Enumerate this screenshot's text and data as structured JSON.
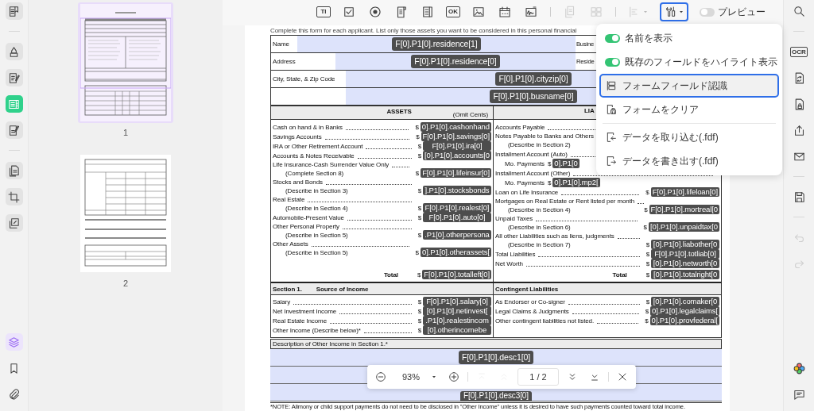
{
  "left_rail": {
    "tools": [
      {
        "kind": "reader",
        "selected": false
      },
      {
        "kind": "highlighter",
        "selected": false
      },
      {
        "kind": "edit",
        "selected": false
      },
      {
        "kind": "form",
        "selected": true
      },
      {
        "kind": "sign",
        "selected": false
      },
      {
        "kind": "pages",
        "selected": false
      },
      {
        "kind": "crop",
        "selected": false
      },
      {
        "kind": "batch",
        "selected": false
      }
    ],
    "panels": [
      {
        "kind": "layers",
        "selected": true
      },
      {
        "kind": "bookmark",
        "selected": false
      },
      {
        "kind": "attachment",
        "selected": false
      }
    ]
  },
  "thumbnails": [
    {
      "label": "1",
      "selected": true
    },
    {
      "label": "2",
      "selected": false
    }
  ],
  "toolbar": {
    "tool_groups": [
      [
        {
          "kind": "text-field",
          "label": "TI",
          "disabled": false
        },
        {
          "kind": "checkbox",
          "disabled": false
        },
        {
          "kind": "radio",
          "disabled": false
        },
        {
          "kind": "list-box",
          "disabled": false
        },
        {
          "kind": "combo-box",
          "disabled": false
        },
        {
          "kind": "push-button",
          "label": "OK",
          "disabled": false
        },
        {
          "kind": "image",
          "disabled": false
        },
        {
          "kind": "date",
          "disabled": false
        },
        {
          "kind": "signature",
          "disabled": false
        }
      ],
      [
        {
          "kind": "duplicate",
          "disabled": true
        },
        {
          "kind": "grid",
          "disabled": true
        }
      ],
      [
        {
          "kind": "align",
          "disabled": true
        }
      ]
    ],
    "form_tools_button": {
      "selected": true
    },
    "preview": {
      "label": "プレビュー",
      "on": false
    }
  },
  "document": {
    "intro": "Complete this form for each applicant.  List only those assets you want to be considered in this personal financial",
    "header_rows": [
      {
        "label": "Name",
        "field": "F[0].P1[0].residence[1]",
        "right_label": "Busine"
      },
      {
        "label": "Address",
        "field": "F[0].P1[0].residence[0]",
        "right_label": "Reside"
      },
      {
        "label": "City, State, & Zip Code",
        "field": "F[0].P1[0].cityzip[0]"
      },
      {
        "field": "F[0].P1[0].busname[0]"
      }
    ],
    "assets_title": "ASSETS",
    "assets_note": "(Omit Cents)",
    "liabilities_title": "LIA",
    "assets": [
      {
        "kind": "line",
        "label": "Cash on hand & in Banks",
        "currency": "$",
        "field": "0].P1[0].cashonhand"
      },
      {
        "kind": "line",
        "label": "Savings Accounts",
        "currency": "$",
        "field": "F[0].P1[0].savings[0]"
      },
      {
        "kind": "line",
        "label": "IRA or Other Retirement Account",
        "currency": "$",
        "field": "F[0].P1[0].ira[0]"
      },
      {
        "kind": "line",
        "label": "Accounts & Notes Receivable",
        "currency": "$",
        "field": "[0].P1[0].accounts[0"
      },
      {
        "kind": "line",
        "label": "Life Insurance-Cash Surrender Value Only",
        "note": "(Complete Section 8)",
        "currency": "$",
        "field": "F[0].P1[0].lifeinsur[0]"
      },
      {
        "kind": "line",
        "label": "Stocks and Bonds",
        "note": "(Describe in Section 3)",
        "currency": "$",
        "field": "].P1[0].stocksbonds"
      },
      {
        "kind": "line",
        "label": "Real Estate",
        "note": "(Describe in Section 4)",
        "currency": "$",
        "field": "F[0].P1[0].realest[0]"
      },
      {
        "kind": "line",
        "label": "Automobile-Present Value",
        "currency": "$",
        "field": "F[0].P1[0].auto[0]"
      },
      {
        "kind": "line",
        "label": "Other Personal Property",
        "note": "(Describe in Section 5)",
        "currency": "$",
        "field": ".P1[0].otherpersona"
      },
      {
        "kind": "line",
        "label": "Other Assets",
        "note": "(Describe in Section 5)",
        "currency": "$",
        "field": "0].P1[0].otherassets["
      },
      {
        "kind": "total",
        "label": "Total",
        "currency": "$",
        "field": "F[0].P1[0].totalleft[0]"
      }
    ],
    "liabilities": [
      {
        "kind": "line",
        "label": "Accounts Payable"
      },
      {
        "kind": "line",
        "label": "Notes Payable to Banks and Others",
        "note": "(Describe in Section 2)"
      },
      {
        "kind": "line",
        "label": "Installment Account (Auto)"
      },
      {
        "kind": "payment",
        "label": "Mo. Payments",
        "currency": "$",
        "field": "0].P1[0"
      },
      {
        "kind": "line",
        "label": "Installment Account (Other)"
      },
      {
        "kind": "payment",
        "label": "Mo. Payments",
        "currency": "$",
        "field": "0].P1[0].mp2["
      },
      {
        "kind": "line",
        "label": "Loan on Life Insurance",
        "currency": "$",
        "field": "F[0].P1[0].lifeloan[0]"
      },
      {
        "kind": "line",
        "label": "Mortgages on Real Estate or Rent listed per month",
        "note": "(Describe in Section 4)",
        "currency": "$",
        "field": "F[0].P1[0].mortreal[0"
      },
      {
        "kind": "line",
        "label": "Unpaid Taxes",
        "note": "(Describe in Section 6)",
        "currency": "$",
        "field": "[0].P1[0].unpaidtax[0"
      },
      {
        "kind": "line",
        "label": "All other Liabilities such as liens, judgments",
        "note": "(Describe in Section 7)",
        "currency": "$",
        "field": "[0].P1[0].liabother[0"
      },
      {
        "kind": "line",
        "label": "Total Liabilities",
        "currency": "$",
        "field": "F[0].P1[0].totliab[0]"
      },
      {
        "kind": "line",
        "label": "Net Worth",
        "currency": "$",
        "field": "[0].P1[0].networth[0"
      },
      {
        "kind": "total",
        "label": "Total",
        "currency": "$",
        "field": "[0].P1[0].totalright[0"
      }
    ],
    "income_header": {
      "number": "Section 1.",
      "title": "Source of Income"
    },
    "contingent_header": {
      "title": "Contingent Liabilities"
    },
    "income": [
      {
        "label": "Salary",
        "currency": "$",
        "field": "F[0].P1[0].salary[0]"
      },
      {
        "label": "Net Investment Income",
        "currency": "$",
        "field": "[0].P1[0].netinvest["
      },
      {
        "label": "Real Estate Income",
        "currency": "$",
        "field": ".P1[0].realestincom"
      },
      {
        "label": "Other Income (Describe below)*",
        "currency": "$",
        "field": "[0].otherincomebe"
      }
    ],
    "contingent": [
      {
        "label": "As Endorser or Co-signer",
        "currency": "$",
        "field": "[0].P1[0].comaker[0"
      },
      {
        "label": "Legal Claims & Judgments",
        "currency": "$",
        "field": "0].P1[0].legalclaims["
      },
      {
        "label": "Other contingent liabilities not listed.",
        "currency": "$",
        "field": "0].P1[0].provfederal["
      }
    ],
    "description_title": "Description of Other Income in Section 1.*",
    "description_fields": [
      "F[0].P1[0].desc1[0]",
      "F[0].P1[0].desc3[0]"
    ],
    "note": "*NOTE: Alimony or child support payments do not need to be disclosed in \"Other Income\" unless it is desired to have such payments counted toward total income."
  },
  "menu": {
    "groups": [
      [
        {
          "kind": "toggle",
          "label": "名前を表示",
          "on": true,
          "selected": false
        },
        {
          "kind": "toggle",
          "label": "既存のフィールドをハイライト表示",
          "on": true,
          "selected": false
        },
        {
          "kind": "recognize",
          "label": "フォームフィールド認識",
          "selected": true
        },
        {
          "kind": "clear",
          "label": "フォームをクリア",
          "selected": false
        }
      ],
      [
        {
          "kind": "import",
          "label": "データを取り込む(.fdf)",
          "selected": false
        },
        {
          "kind": "export",
          "label": "データを書き出す(.fdf)",
          "selected": false
        }
      ]
    ]
  },
  "zoom_bar": {
    "zoom": "93%",
    "page": "1 / 2",
    "buttons": [
      {
        "kind": "first",
        "disabled": true
      },
      {
        "kind": "prev",
        "disabled": true
      },
      {
        "kind": "next",
        "disabled": false
      },
      {
        "kind": "last",
        "disabled": false
      }
    ]
  },
  "right_rail": {
    "groups": [
      [
        {
          "kind": "search",
          "disabled": false
        }
      ],
      [
        {
          "kind": "ocr",
          "label": "OCR",
          "disabled": false
        },
        {
          "kind": "convert",
          "disabled": false
        },
        {
          "kind": "protect",
          "disabled": false
        },
        {
          "kind": "share",
          "disabled": false
        },
        {
          "kind": "mail",
          "disabled": false
        }
      ],
      [
        {
          "kind": "save",
          "disabled": false
        }
      ],
      [
        {
          "kind": "undo",
          "disabled": true
        },
        {
          "kind": "redo",
          "disabled": true
        }
      ]
    ],
    "bottom": [
      {
        "kind": "ai",
        "disabled": false
      },
      {
        "kind": "comment",
        "disabled": false
      }
    ]
  }
}
